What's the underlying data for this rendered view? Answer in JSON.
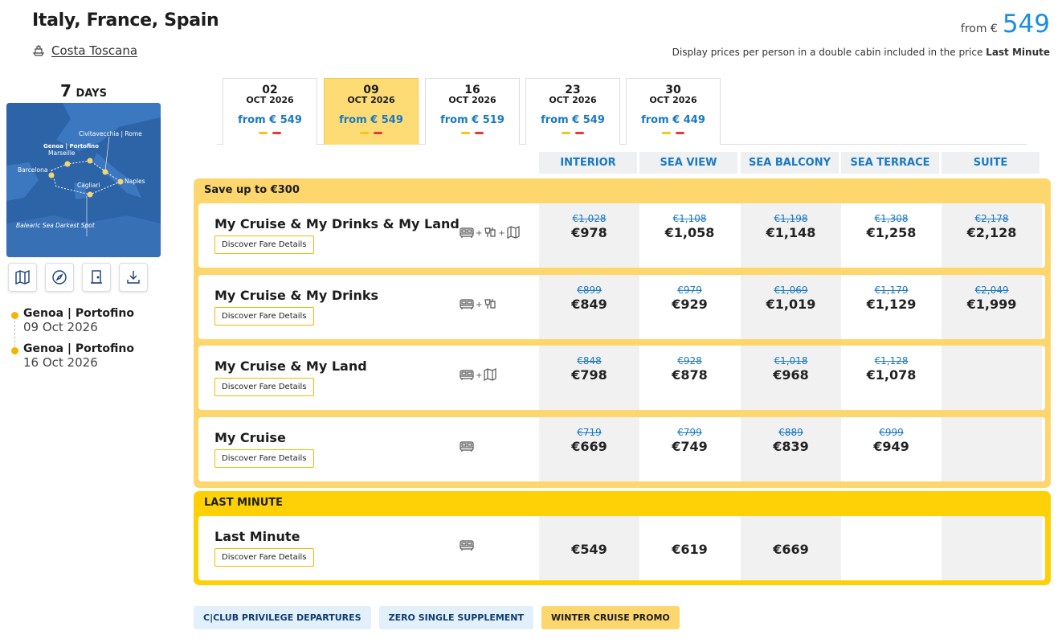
{
  "header": {
    "title": "Italy, France, Spain",
    "ship_name": "Costa Toscana",
    "from_label": "from €",
    "from_price": "549",
    "note_prefix": "Display prices per person in a double cabin included in the price",
    "note_strong": "Last Minute"
  },
  "sidebar": {
    "days_number": "7",
    "days_unit": "DAYS",
    "map_labels": {
      "civitavecchia": "Civitavecchia | Rome",
      "genoa": "Genoa | Portofino",
      "marseille": "Marseille",
      "barcelona": "Barcelona",
      "naples": "Naples",
      "cagliari": "Cagliari",
      "spot": "Balearic Sea Darkest Spot"
    },
    "actions": [
      "map-icon",
      "compass-icon",
      "door-icon",
      "download-icon"
    ],
    "itinerary": [
      {
        "port": "Genoa | Portofino",
        "date": "09 Oct 2026"
      },
      {
        "port": "Genoa | Portofino",
        "date": "16 Oct 2026"
      }
    ]
  },
  "dates": [
    {
      "day": "02",
      "month": "OCT 2026",
      "price": "from € 549",
      "active": false
    },
    {
      "day": "09",
      "month": "OCT 2026",
      "price": "from € 549",
      "active": true
    },
    {
      "day": "16",
      "month": "OCT 2026",
      "price": "from € 519",
      "active": false
    },
    {
      "day": "23",
      "month": "OCT 2026",
      "price": "from € 549",
      "active": false
    },
    {
      "day": "30",
      "month": "OCT 2026",
      "price": "from € 449",
      "active": false
    }
  ],
  "cabins": [
    "INTERIOR",
    "SEA VIEW",
    "SEA BALCONY",
    "SEA TERRACE",
    "SUITE"
  ],
  "groups": [
    {
      "title": "Save up to €300",
      "rows": [
        {
          "name": "My Cruise & My Drinks & My Land",
          "button": "Discover Fare Details",
          "icons": [
            "bed-icon",
            "drinks-icon",
            "map-icon"
          ],
          "prices": [
            {
              "old": "€1,028",
              "new": "€978"
            },
            {
              "old": "€1,108",
              "new": "€1,058"
            },
            {
              "old": "€1,198",
              "new": "€1,148"
            },
            {
              "old": "€1,308",
              "new": "€1,258"
            },
            {
              "old": "€2,178",
              "new": "€2,128"
            }
          ]
        },
        {
          "name": "My Cruise & My Drinks",
          "button": "Discover Fare Details",
          "icons": [
            "bed-icon",
            "drinks-icon"
          ],
          "prices": [
            {
              "old": "€899",
              "new": "€849"
            },
            {
              "old": "€979",
              "new": "€929"
            },
            {
              "old": "€1,069",
              "new": "€1,019"
            },
            {
              "old": "€1,179",
              "new": "€1,129"
            },
            {
              "old": "€2,049",
              "new": "€1,999"
            }
          ]
        },
        {
          "name": "My Cruise & My Land",
          "button": "Discover Fare Details",
          "icons": [
            "bed-icon",
            "map-icon"
          ],
          "prices": [
            {
              "old": "€848",
              "new": "€798"
            },
            {
              "old": "€928",
              "new": "€878"
            },
            {
              "old": "€1,018",
              "new": "€968"
            },
            {
              "old": "€1,128",
              "new": "€1,078"
            },
            null
          ]
        },
        {
          "name": "My Cruise",
          "button": "Discover Fare Details",
          "icons": [
            "bed-icon"
          ],
          "prices": [
            {
              "old": "€719",
              "new": "€669"
            },
            {
              "old": "€799",
              "new": "€749"
            },
            {
              "old": "€889",
              "new": "€839"
            },
            {
              "old": "€999",
              "new": "€949"
            },
            null
          ]
        }
      ]
    },
    {
      "title": "LAST MINUTE",
      "rows": [
        {
          "name": "Last Minute",
          "button": "Discover Fare Details",
          "icons": [
            "bed-icon"
          ],
          "prices": [
            {
              "old": "",
              "new": "€549"
            },
            {
              "old": "",
              "new": "€619"
            },
            {
              "old": "",
              "new": "€669"
            },
            null,
            null
          ]
        }
      ]
    }
  ],
  "badges": [
    {
      "label": "C|CLUB PRIVILEGE DEPARTURES",
      "style": "blue"
    },
    {
      "label": "ZERO SINGLE SUPPLEMENT",
      "style": "blue"
    },
    {
      "label": "WINTER CRUISE PROMO",
      "style": "yellow"
    }
  ],
  "colors": {
    "accent_blue": "#1a8fe0",
    "promo_yellow": "#fdd66d",
    "last_minute_yellow": "#fdd106",
    "dash_yellow": "#f5c518",
    "dash_red": "#e53935"
  }
}
